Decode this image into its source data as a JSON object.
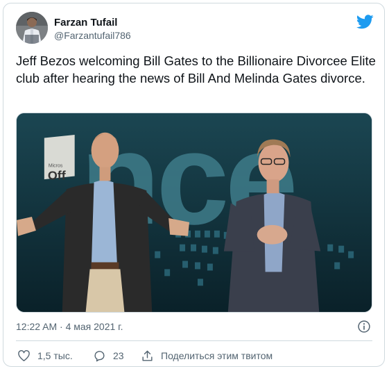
{
  "author": {
    "display_name": "Farzan Tufail",
    "handle": "@Farzantufail786"
  },
  "tweet": {
    "text": "Jeff Bezos welcoming Bill Gates to the Billionaire Divorcee Elite club after hearing the news of Bill And Melinda Gates divorce.",
    "timestamp": "12:22 AM · 4 мая 2021 г."
  },
  "photo": {
    "backdrop_letters": "nce",
    "sign_text": "Micros",
    "sign_text_big": "Off"
  },
  "actions": {
    "like_count": "1,5 тыс.",
    "reply_count": "23",
    "share_label": "Поделиться этим твитом"
  },
  "icons": {
    "brand": "twitter-bird-icon",
    "info": "info-icon",
    "like": "heart-icon",
    "reply": "reply-bubble-icon",
    "share": "share-upload-icon"
  },
  "colors": {
    "twitter_blue": "#1d9bf0",
    "text_primary": "#0f1419",
    "text_secondary": "#536471",
    "border": "#cfd9de"
  }
}
